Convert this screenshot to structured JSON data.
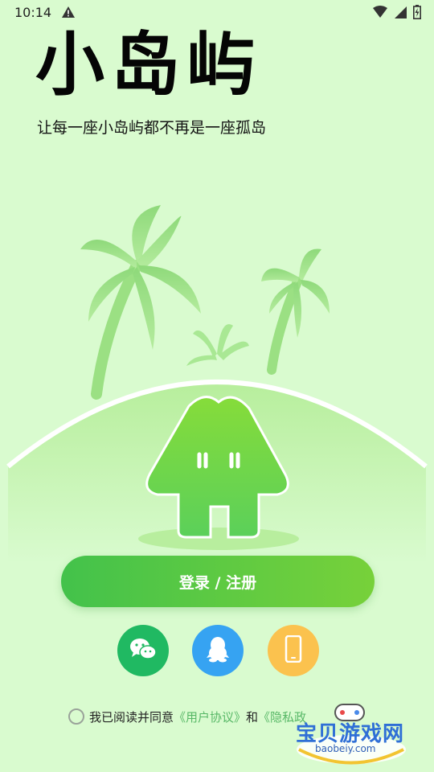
{
  "status_bar": {
    "time": "10:14"
  },
  "header": {
    "title": "小岛屿",
    "subtitle": "让每一座小岛屿都不再是一座孤岛"
  },
  "login": {
    "button_label": "登录 / 注册"
  },
  "social": [
    {
      "name": "wechat",
      "color": "#20b962"
    },
    {
      "name": "qq",
      "color": "#36a3f2"
    },
    {
      "name": "phone",
      "color": "#fbc24e"
    }
  ],
  "agreement": {
    "prefix": "我已阅读并同意",
    "user_agreement": "《用户协议》",
    "and": "和",
    "privacy_policy": "《隐私政"
  },
  "watermark": {
    "text": "宝贝游戏网",
    "url": "baobeiy.com"
  },
  "colors": {
    "background": "#d9fbcf",
    "accent": "#43c24b",
    "link": "#58b867"
  }
}
